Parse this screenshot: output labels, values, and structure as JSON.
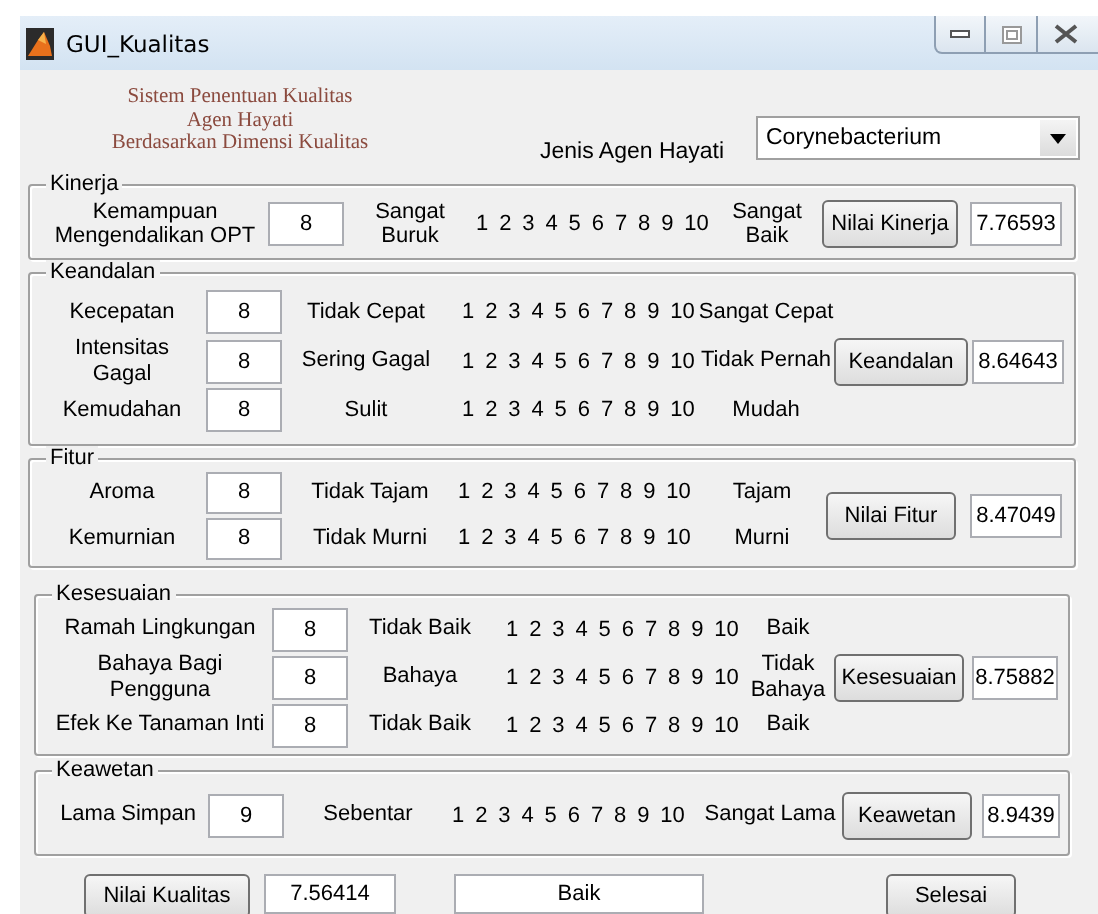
{
  "window": {
    "title": "GUI_Kualitas"
  },
  "header": {
    "title_lines": [
      "Sistem Penentuan Kualitas",
      "Agen Hayati",
      "Berdasarkan Dimensi Kualitas"
    ],
    "dropdown_label": "Jenis Agen Hayati",
    "dropdown_value": "Corynebacterium"
  },
  "groups": [
    {
      "title": "Kinerja",
      "rows": [
        {
          "label": "Kemampuan Mengendalikan OPT",
          "value": "8",
          "low": "Sangat Buruk",
          "scale": "1 2 3 4 5 6 7 8 9 10",
          "high": "Sangat Baik"
        }
      ],
      "button": "Nilai Kinerja",
      "result": "7.76593"
    },
    {
      "title": "Keandalan",
      "rows": [
        {
          "label": "Kecepatan",
          "value": "8",
          "low": "Tidak Cepat",
          "scale": "1 2 3 4 5 6 7 8 9 10",
          "high": "Sangat Cepat"
        },
        {
          "label": "Intensitas Gagal",
          "value": "8",
          "low": "Sering Gagal",
          "scale": "1 2 3 4 5 6 7 8 9 10",
          "high": "Tidak Pernah"
        },
        {
          "label": "Kemudahan",
          "value": "8",
          "low": "Sulit",
          "scale": "1 2 3 4 5 6 7 8 9 10",
          "high": "Mudah"
        }
      ],
      "button": "Keandalan",
      "result": "8.64643"
    },
    {
      "title": "Fitur",
      "rows": [
        {
          "label": "Aroma",
          "value": "8",
          "low": "Tidak Tajam",
          "scale": "1 2 3 4 5 6 7 8 9 10",
          "high": "Tajam"
        },
        {
          "label": "Kemurnian",
          "value": "8",
          "low": "Tidak Murni",
          "scale": "1 2 3 4 5 6 7 8 9 10",
          "high": "Murni"
        }
      ],
      "button": "Nilai Fitur",
      "result": "8.47049"
    },
    {
      "title": "Kesesuaian",
      "rows": [
        {
          "label": "Ramah Lingkungan",
          "value": "8",
          "low": "Tidak Baik",
          "scale": "1 2 3 4 5 6 7 8 9 10",
          "high": "Baik"
        },
        {
          "label": "Bahaya Bagi Pengguna",
          "value": "8",
          "low": "Bahaya",
          "scale": "1 2 3 4 5 6 7 8 9 10",
          "high": "Tidak Bahaya"
        },
        {
          "label": "Efek Ke Tanaman Inti",
          "value": "8",
          "low": "Tidak Baik",
          "scale": "1 2 3 4 5 6 7 8 9 10",
          "high": "Baik"
        }
      ],
      "button": "Kesesuaian",
      "result": "8.75882"
    },
    {
      "title": "Keawetan",
      "rows": [
        {
          "label": "Lama Simpan",
          "value": "9",
          "low": "Sebentar",
          "scale": "1 2 3 4 5 6 7 8 9 10",
          "high": "Sangat Lama"
        }
      ],
      "button": "Keawetan",
      "result": "8.9439"
    }
  ],
  "footer": {
    "button": "Nilai Kualitas",
    "score": "7.56414",
    "verdict": "Baik",
    "close_button": "Selesai"
  }
}
